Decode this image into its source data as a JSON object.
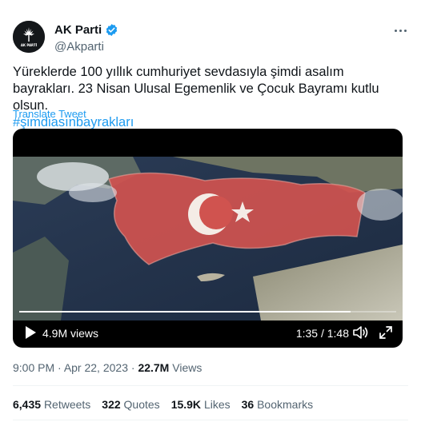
{
  "author": {
    "display_name": "AK Parti",
    "handle": "@Akparti",
    "avatar_text": "AK PARTİ"
  },
  "tweet": {
    "text": "Yüreklerde 100 yıllık cumhuriyet sevdasıyla şimdi asalım bayrakları. 23 Nisan Ulusal Egemenlik ve Çocuk Bayramı kutlu olsun.",
    "hashtag": "#şimdiasınbayrakları",
    "translate_label": "Translate Tweet"
  },
  "video": {
    "views_label": "4.9M views",
    "current_time": "1:35",
    "duration": "1:48",
    "time_separator": " / ",
    "progress_fraction": 0.88
  },
  "meta": {
    "time": "9:00 PM",
    "separator": " · ",
    "date": "Apr 22, 2023",
    "views_count": "22.7M",
    "views_label": "Views"
  },
  "stats": {
    "retweets_count": "6,435",
    "retweets_label": "Retweets",
    "quotes_count": "322",
    "quotes_label": "Quotes",
    "likes_count": "15.9K",
    "likes_label": "Likes",
    "bookmarks_count": "36",
    "bookmarks_label": "Bookmarks"
  },
  "colors": {
    "accent": "#1d9bf0",
    "text": "#0f1419",
    "secondary": "#536471",
    "flag_red": "#d0534f"
  },
  "icons": [
    "ak-party-logo-icon",
    "verified-badge-icon",
    "more-icon",
    "play-icon",
    "volume-icon",
    "fullscreen-icon"
  ]
}
